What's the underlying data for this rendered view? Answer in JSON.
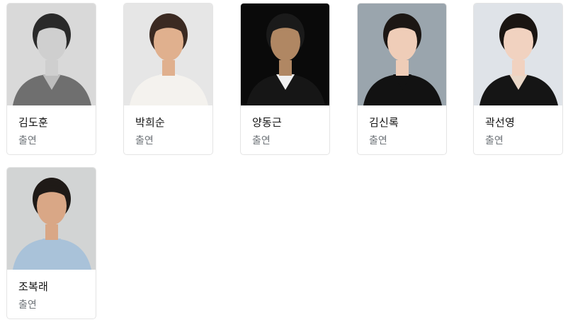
{
  "cast": [
    {
      "name": "김도훈",
      "role": "출연",
      "photo_icon": "person-photo",
      "bg": "#d9d9d9",
      "skin": "#cfcfcf",
      "hair": "#2a2a2a",
      "cloth": "#6f6f6f",
      "inner": "#bdbdbd"
    },
    {
      "name": "박희순",
      "role": "출연",
      "photo_icon": "person-photo",
      "bg": "#e6e6e6",
      "skin": "#e0b08e",
      "hair": "#3b2a22",
      "cloth": "#f4f2ee",
      "inner": "#f4f2ee"
    },
    {
      "name": "양동근",
      "role": "출연",
      "photo_icon": "person-photo",
      "bg": "#0a0a0a",
      "skin": "#b08763",
      "hair": "#1a1a1a",
      "cloth": "#161616",
      "inner": "#f0f0f0"
    },
    {
      "name": "김신록",
      "role": "출연",
      "photo_icon": "person-photo",
      "bg": "#9aa5ad",
      "skin": "#efcdb8",
      "hair": "#1c1714",
      "cloth": "#121212",
      "inner": "#121212"
    },
    {
      "name": "곽선영",
      "role": "출연",
      "photo_icon": "person-photo",
      "bg": "#dfe3e8",
      "skin": "#f1d2c0",
      "hair": "#1a1512",
      "cloth": "#151515",
      "inner": "#ead8c8"
    },
    {
      "name": "조복래",
      "role": "출연",
      "photo_icon": "person-photo",
      "bg": "#d2d4d4",
      "skin": "#d9a786",
      "hair": "#1f1a17",
      "cloth": "#a9c2d9",
      "inner": "#a9c2d9"
    }
  ]
}
